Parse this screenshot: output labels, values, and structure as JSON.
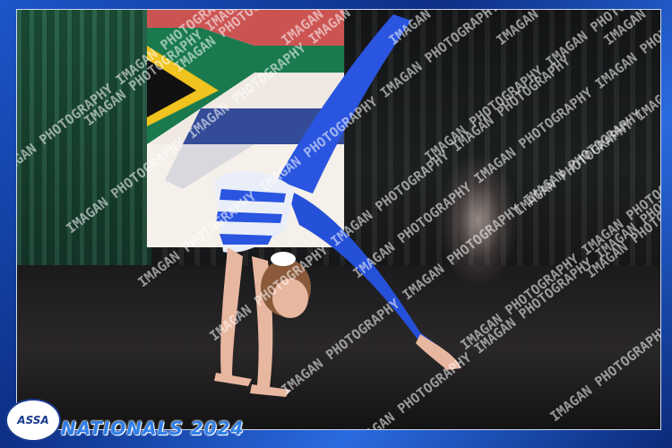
{
  "scene": {
    "subject": "dancer-backbend",
    "costume_color": "#2a55e0",
    "backdrop_flag": "south-african-flag"
  },
  "watermark": {
    "text": "IMAGAN PHOTOGRAPHY"
  },
  "branding": {
    "logo_text": "ASSA",
    "event_title": "NATIONALS 2024"
  },
  "colors": {
    "frame_blue": "#1c56c9",
    "accent_gold": "#f2c94c"
  }
}
